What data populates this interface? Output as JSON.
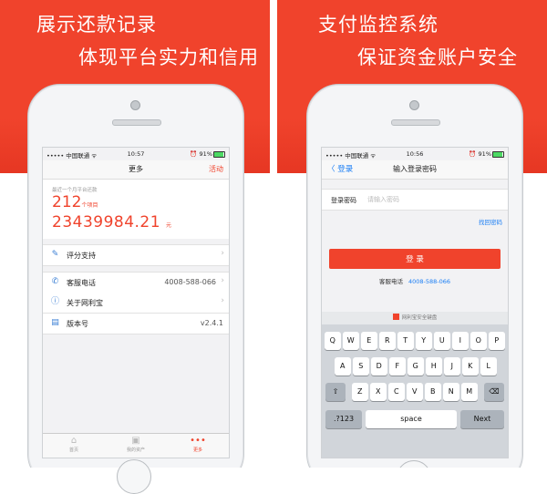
{
  "left_panel": {
    "headline_1": "展示还款记录",
    "headline_2": "体现平台实力和信用",
    "status": {
      "carrier": "••••• 中国联通 ᯤ",
      "time": "10:57",
      "battery": "⏰ 91%",
      "battery_level": 0.91
    },
    "nav": {
      "title": "更多",
      "action": "活动"
    },
    "stats": {
      "caption": "最近一个月平台还款",
      "count_value": "212",
      "count_unit": "个项目",
      "amount_value": "23439984.21",
      "amount_unit": "元"
    },
    "rows": [
      {
        "label": "评分支持",
        "value": "",
        "icon": "edit-icon"
      },
      {
        "label": "客服电话",
        "value": "4008-588-066",
        "icon": "phone-icon"
      },
      {
        "label": "关于网利宝",
        "value": "",
        "icon": "info-icon"
      },
      {
        "label": "版本号",
        "value": "v2.4.1",
        "icon": "version-icon"
      }
    ],
    "tabs": [
      {
        "label": "首页",
        "icon": "home-icon"
      },
      {
        "label": "我的资产",
        "icon": "wallet-icon"
      },
      {
        "label": "更多",
        "icon": "more-icon",
        "active": true
      }
    ]
  },
  "right_panel": {
    "headline_1": "支付监控系统",
    "headline_2": "保证资金账户安全",
    "status": {
      "carrier": "••••• 中国联通 ᯤ",
      "time": "10:56",
      "battery": "⏰ 91%",
      "battery_level": 0.91
    },
    "nav": {
      "back": "〈 登录",
      "title": "输入登录密码"
    },
    "password_label": "登录密码",
    "password_placeholder": "请输入密码",
    "find_password": "找回密码",
    "login_button": "登 录",
    "service_label": "客服电话",
    "service_phone": "4008-588-066",
    "keyboard": {
      "title": "网利宝安全键盘",
      "row1": [
        "Q",
        "W",
        "E",
        "R",
        "T",
        "Y",
        "U",
        "I",
        "O",
        "P"
      ],
      "row2": [
        "A",
        "S",
        "D",
        "F",
        "G",
        "H",
        "J",
        "K",
        "L"
      ],
      "row3": [
        "Z",
        "X",
        "C",
        "V",
        "B",
        "N",
        "M"
      ],
      "shift": "⇧",
      "delete": "⌫",
      "num": ".?123",
      "space": "space",
      "next": "Next"
    }
  },
  "colors": {
    "accent": "#f0432c",
    "link": "#1a7ef5"
  }
}
